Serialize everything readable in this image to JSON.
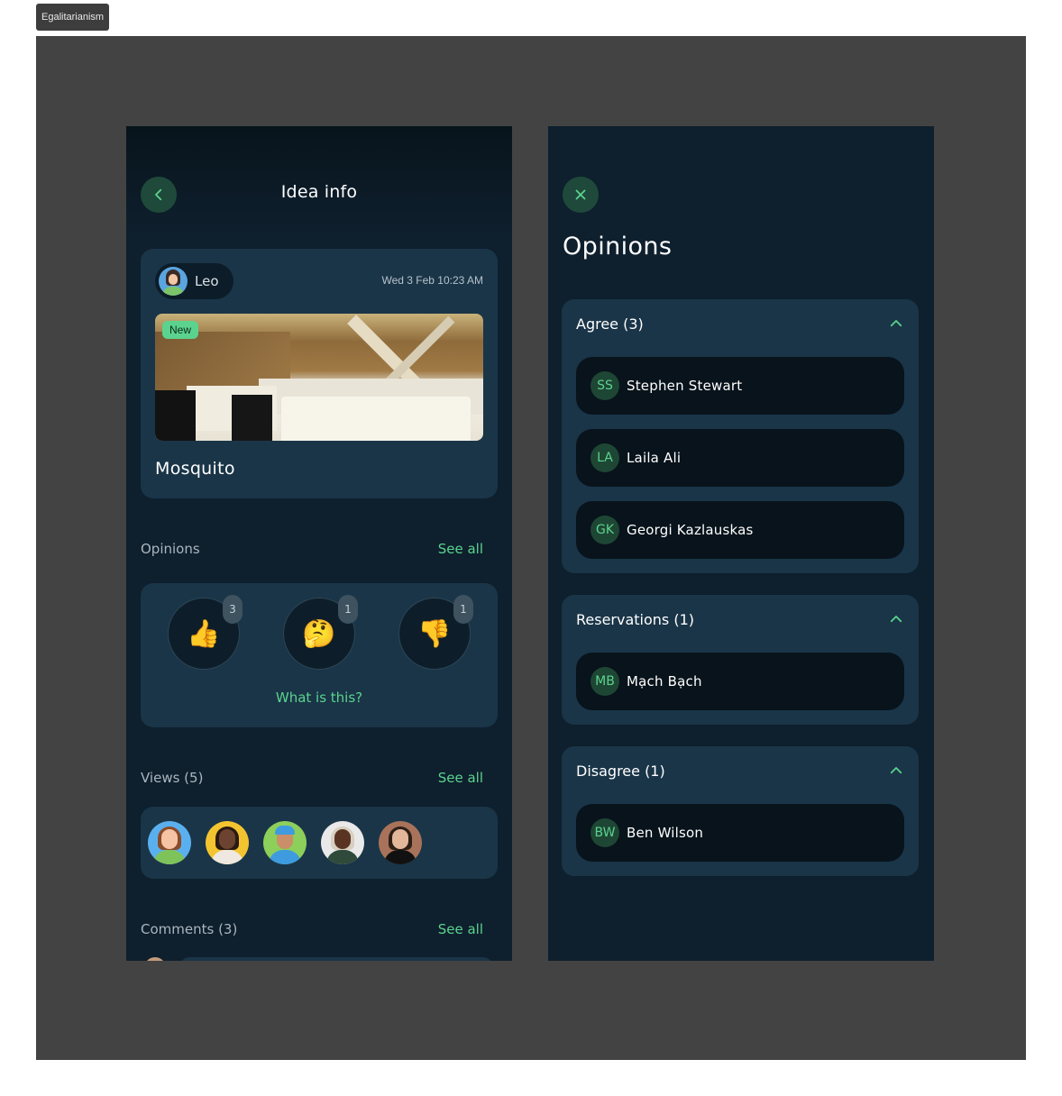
{
  "frame_label": "Egalitarianism",
  "idea_screen": {
    "header": {
      "title": "Idea info",
      "back_icon": "chevron-left-icon"
    },
    "idea": {
      "author": "Leo",
      "date": "Wed 3 Feb 10:23 AM",
      "badge": "New",
      "name": "Mosquito"
    },
    "opinions": {
      "label": "Opinions",
      "see_all": "See all",
      "reactions": [
        {
          "name": "agree",
          "emoji": "👍",
          "count": "3"
        },
        {
          "name": "reservations",
          "emoji": "🤔",
          "count": "1"
        },
        {
          "name": "disagree",
          "emoji": "👎",
          "count": "1"
        }
      ],
      "help_link": "What is this?"
    },
    "views": {
      "label": "Views (5)",
      "see_all": "See all"
    },
    "comments": {
      "label": "Comments (3)",
      "see_all": "See all"
    }
  },
  "opinions_screen": {
    "close_icon": "close-icon",
    "title": "Opinions",
    "groups": [
      {
        "title": "Agree (3)",
        "people": [
          {
            "initials": "SS",
            "name": "Stephen Stewart"
          },
          {
            "initials": "LA",
            "name": "Laila Ali"
          },
          {
            "initials": "GK",
            "name": "Georgi Kazlauskas"
          }
        ]
      },
      {
        "title": "Reservations (1)",
        "people": [
          {
            "initials": "MB",
            "name": "Mạch Bạch"
          }
        ]
      },
      {
        "title": "Disagree (1)",
        "people": [
          {
            "initials": "BW",
            "name": "Ben Wilson"
          }
        ]
      }
    ]
  },
  "colors": {
    "accent": "#5bd38e",
    "screen_bg": "#0e1f2d",
    "card_bg": "#1a3548",
    "canvas_bg": "#434343"
  }
}
